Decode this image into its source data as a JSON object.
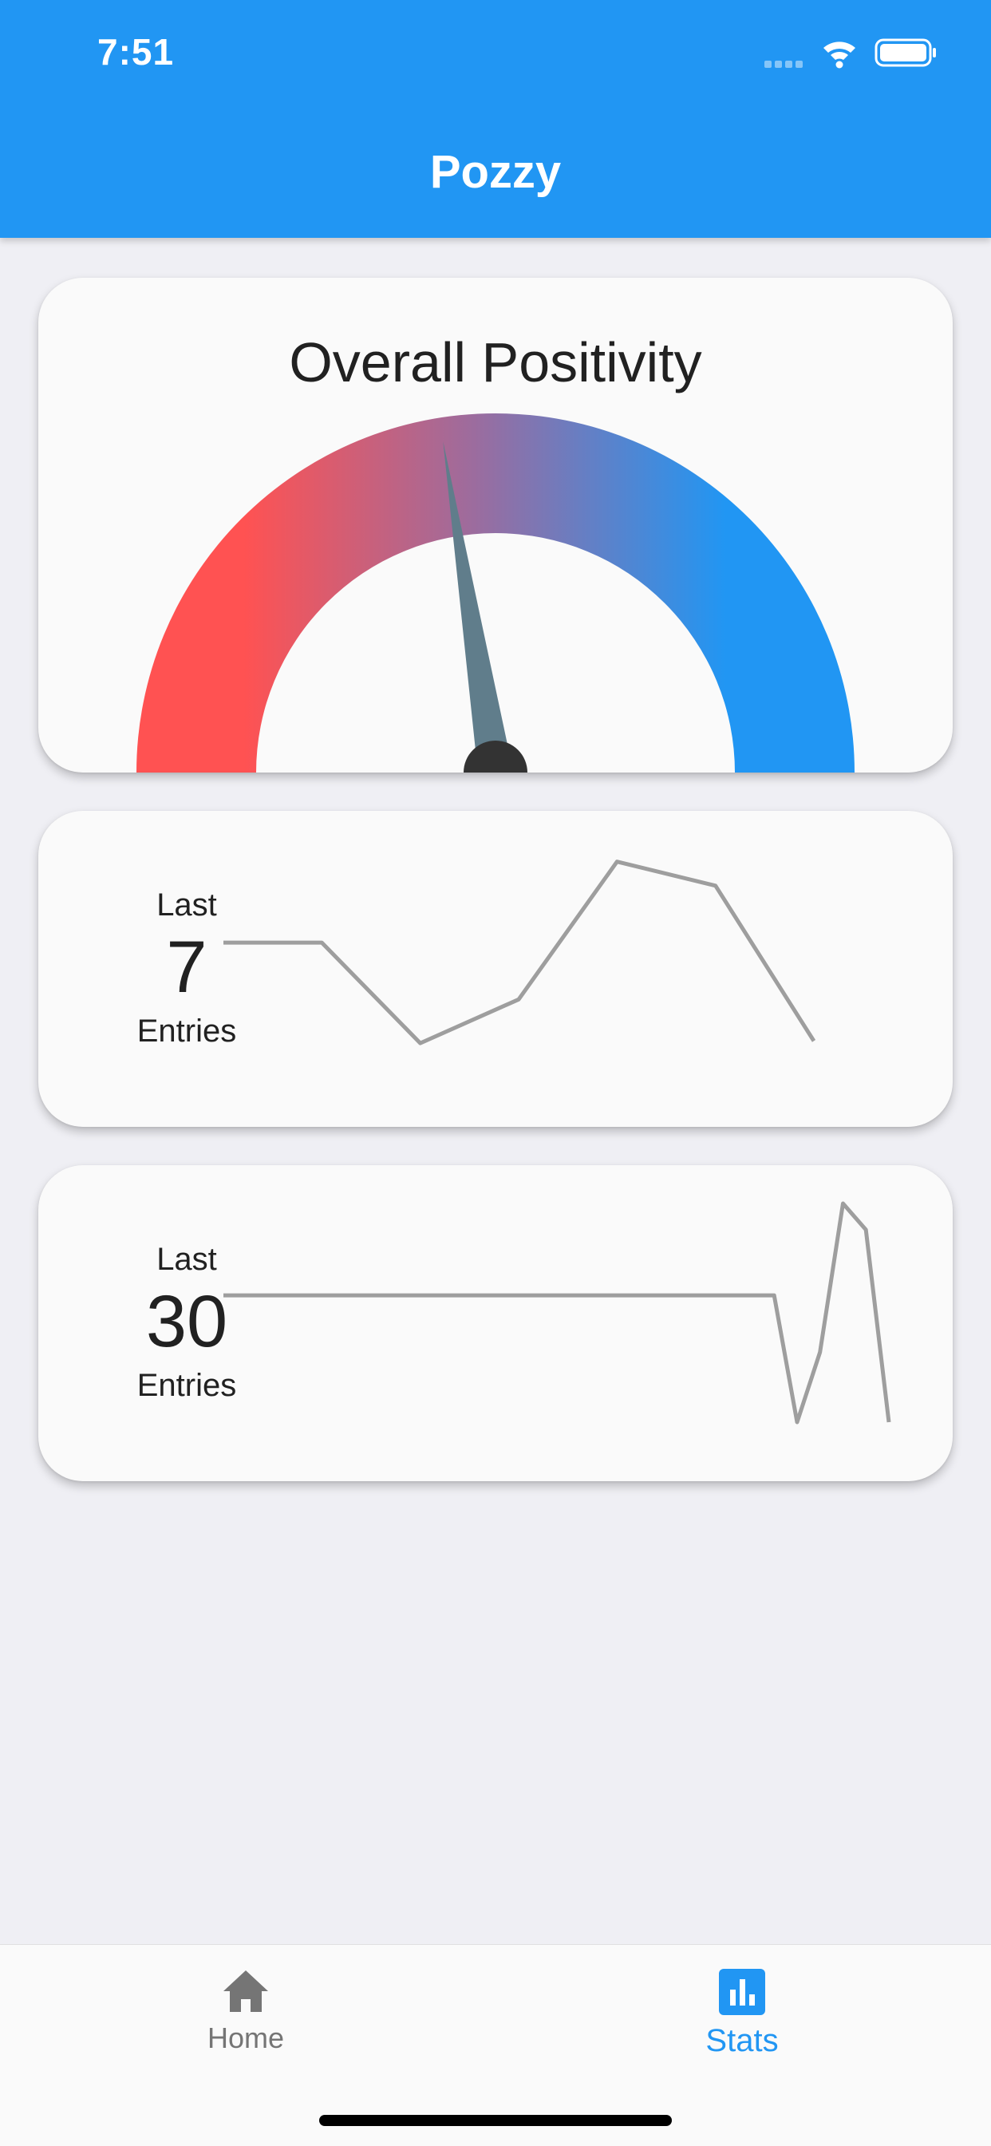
{
  "status_bar": {
    "time": "7:51"
  },
  "app_bar": {
    "title": "Pozzy"
  },
  "gauge_card": {
    "title": "Overall Positivity",
    "needle_fraction": 0.45,
    "colors": {
      "negative": "#ff5252",
      "positive": "#2196f3",
      "needle": "#607d8b",
      "hub": "#333333"
    }
  },
  "last7_card": {
    "prefix": "Last",
    "count": "7",
    "suffix": "Entries",
    "values": [
      0.58,
      0.58,
      0.12,
      0.32,
      0.95,
      0.84,
      0.13
    ],
    "line_color": "#9e9e9e"
  },
  "last30_card": {
    "prefix": "Last",
    "count": "30",
    "suffix": "Entries",
    "values": [
      0.58,
      0.58,
      0.58,
      0.58,
      0.58,
      0.58,
      0.58,
      0.58,
      0.58,
      0.58,
      0.58,
      0.58,
      0.58,
      0.58,
      0.58,
      0.58,
      0.58,
      0.58,
      0.58,
      0.58,
      0.58,
      0.58,
      0.58,
      0.58,
      0.58,
      0.0,
      0.32,
      1.0,
      0.88,
      0.0
    ],
    "line_color": "#9e9e9e"
  },
  "bottom_nav": {
    "items": [
      {
        "label": "Home",
        "icon": "home-icon",
        "active": false
      },
      {
        "label": "Stats",
        "icon": "bar-chart-icon",
        "active": true
      }
    ],
    "active_color": "#2196f3",
    "inactive_color": "#757575"
  }
}
